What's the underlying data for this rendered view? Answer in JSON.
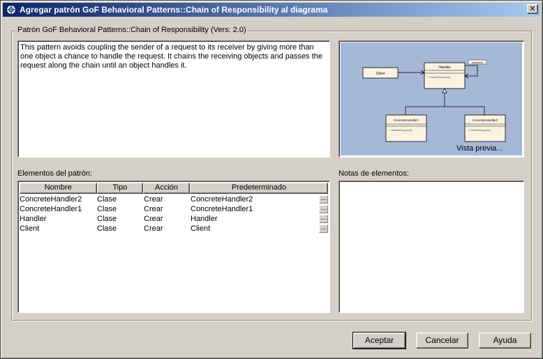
{
  "window": {
    "title": "Agregar patrón GoF Behavioral Patterns::Chain of Responsibility al diagrama",
    "close_glyph": "✕"
  },
  "pattern": {
    "group_label": "Patrón GoF Behavioral Patterns::Chain of Responsibility (Vers: 2.0)",
    "description": "This pattern avoids coupling the sender of a request to its receiver by giving more than one object a chance to handle the request. It chains the receiving objects and passes the request along the chain until an object handles it."
  },
  "preview": {
    "caption": "Vista previa...",
    "classes": {
      "client": "Client",
      "handler": "Handler",
      "handler_op": "+ HandleRequest()",
      "concrete1": "ConcreteHandler1",
      "concrete1_op": "+ HandleRequest()",
      "concrete2": "ConcreteHandler2",
      "concrete2_op": "+ HandleRequest()",
      "successor": "successor"
    }
  },
  "elements": {
    "label": "Elementos del patrón:",
    "columns": [
      "Nombre",
      "Tipo",
      "Acción",
      "Predeterminado"
    ],
    "rows": [
      {
        "nombre": "ConcreteHandler2",
        "tipo": "Clase",
        "accion": "Crear",
        "predeterminado": "ConcreteHandler2"
      },
      {
        "nombre": "ConcreteHandler1",
        "tipo": "Clase",
        "accion": "Crear",
        "predeterminado": "ConcreteHandler1"
      },
      {
        "nombre": "Handler",
        "tipo": "Clase",
        "accion": "Crear",
        "predeterminado": "Handler"
      },
      {
        "nombre": "Client",
        "tipo": "Clase",
        "accion": "Crear",
        "predeterminado": "Client"
      }
    ],
    "row_button": "..."
  },
  "notes": {
    "label": "Notas de elementos:"
  },
  "buttons": {
    "accept": "Aceptar",
    "cancel": "Cancelar",
    "help": "Ayuda"
  },
  "colors": {
    "titlebar_start": "#0a246a",
    "titlebar_end": "#a6caf0",
    "dialog_bg": "#d4d0c8",
    "preview_bg": "#a6b8d8",
    "class_fill": "#fbf3e2"
  }
}
